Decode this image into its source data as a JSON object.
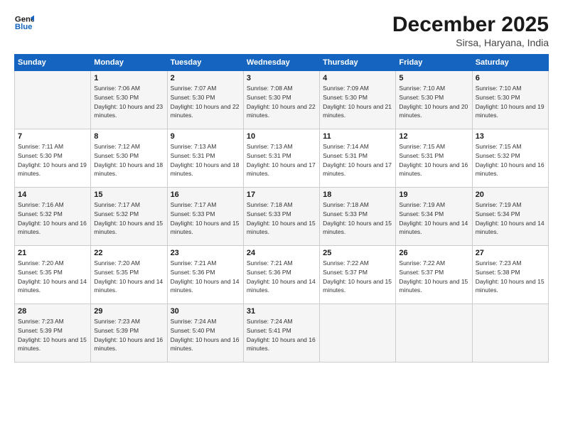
{
  "header": {
    "logo_line1": "General",
    "logo_line2": "Blue",
    "month": "December 2025",
    "location": "Sirsa, Haryana, India"
  },
  "weekdays": [
    "Sunday",
    "Monday",
    "Tuesday",
    "Wednesday",
    "Thursday",
    "Friday",
    "Saturday"
  ],
  "weeks": [
    [
      {
        "day": "",
        "sunrise": "",
        "sunset": "",
        "daylight": ""
      },
      {
        "day": "1",
        "sunrise": "Sunrise: 7:06 AM",
        "sunset": "Sunset: 5:30 PM",
        "daylight": "Daylight: 10 hours and 23 minutes."
      },
      {
        "day": "2",
        "sunrise": "Sunrise: 7:07 AM",
        "sunset": "Sunset: 5:30 PM",
        "daylight": "Daylight: 10 hours and 22 minutes."
      },
      {
        "day": "3",
        "sunrise": "Sunrise: 7:08 AM",
        "sunset": "Sunset: 5:30 PM",
        "daylight": "Daylight: 10 hours and 22 minutes."
      },
      {
        "day": "4",
        "sunrise": "Sunrise: 7:09 AM",
        "sunset": "Sunset: 5:30 PM",
        "daylight": "Daylight: 10 hours and 21 minutes."
      },
      {
        "day": "5",
        "sunrise": "Sunrise: 7:10 AM",
        "sunset": "Sunset: 5:30 PM",
        "daylight": "Daylight: 10 hours and 20 minutes."
      },
      {
        "day": "6",
        "sunrise": "Sunrise: 7:10 AM",
        "sunset": "Sunset: 5:30 PM",
        "daylight": "Daylight: 10 hours and 19 minutes."
      }
    ],
    [
      {
        "day": "7",
        "sunrise": "Sunrise: 7:11 AM",
        "sunset": "Sunset: 5:30 PM",
        "daylight": "Daylight: 10 hours and 19 minutes."
      },
      {
        "day": "8",
        "sunrise": "Sunrise: 7:12 AM",
        "sunset": "Sunset: 5:30 PM",
        "daylight": "Daylight: 10 hours and 18 minutes."
      },
      {
        "day": "9",
        "sunrise": "Sunrise: 7:13 AM",
        "sunset": "Sunset: 5:31 PM",
        "daylight": "Daylight: 10 hours and 18 minutes."
      },
      {
        "day": "10",
        "sunrise": "Sunrise: 7:13 AM",
        "sunset": "Sunset: 5:31 PM",
        "daylight": "Daylight: 10 hours and 17 minutes."
      },
      {
        "day": "11",
        "sunrise": "Sunrise: 7:14 AM",
        "sunset": "Sunset: 5:31 PM",
        "daylight": "Daylight: 10 hours and 17 minutes."
      },
      {
        "day": "12",
        "sunrise": "Sunrise: 7:15 AM",
        "sunset": "Sunset: 5:31 PM",
        "daylight": "Daylight: 10 hours and 16 minutes."
      },
      {
        "day": "13",
        "sunrise": "Sunrise: 7:15 AM",
        "sunset": "Sunset: 5:32 PM",
        "daylight": "Daylight: 10 hours and 16 minutes."
      }
    ],
    [
      {
        "day": "14",
        "sunrise": "Sunrise: 7:16 AM",
        "sunset": "Sunset: 5:32 PM",
        "daylight": "Daylight: 10 hours and 16 minutes."
      },
      {
        "day": "15",
        "sunrise": "Sunrise: 7:17 AM",
        "sunset": "Sunset: 5:32 PM",
        "daylight": "Daylight: 10 hours and 15 minutes."
      },
      {
        "day": "16",
        "sunrise": "Sunrise: 7:17 AM",
        "sunset": "Sunset: 5:33 PM",
        "daylight": "Daylight: 10 hours and 15 minutes."
      },
      {
        "day": "17",
        "sunrise": "Sunrise: 7:18 AM",
        "sunset": "Sunset: 5:33 PM",
        "daylight": "Daylight: 10 hours and 15 minutes."
      },
      {
        "day": "18",
        "sunrise": "Sunrise: 7:18 AM",
        "sunset": "Sunset: 5:33 PM",
        "daylight": "Daylight: 10 hours and 15 minutes."
      },
      {
        "day": "19",
        "sunrise": "Sunrise: 7:19 AM",
        "sunset": "Sunset: 5:34 PM",
        "daylight": "Daylight: 10 hours and 14 minutes."
      },
      {
        "day": "20",
        "sunrise": "Sunrise: 7:19 AM",
        "sunset": "Sunset: 5:34 PM",
        "daylight": "Daylight: 10 hours and 14 minutes."
      }
    ],
    [
      {
        "day": "21",
        "sunrise": "Sunrise: 7:20 AM",
        "sunset": "Sunset: 5:35 PM",
        "daylight": "Daylight: 10 hours and 14 minutes."
      },
      {
        "day": "22",
        "sunrise": "Sunrise: 7:20 AM",
        "sunset": "Sunset: 5:35 PM",
        "daylight": "Daylight: 10 hours and 14 minutes."
      },
      {
        "day": "23",
        "sunrise": "Sunrise: 7:21 AM",
        "sunset": "Sunset: 5:36 PM",
        "daylight": "Daylight: 10 hours and 14 minutes."
      },
      {
        "day": "24",
        "sunrise": "Sunrise: 7:21 AM",
        "sunset": "Sunset: 5:36 PM",
        "daylight": "Daylight: 10 hours and 14 minutes."
      },
      {
        "day": "25",
        "sunrise": "Sunrise: 7:22 AM",
        "sunset": "Sunset: 5:37 PM",
        "daylight": "Daylight: 10 hours and 15 minutes."
      },
      {
        "day": "26",
        "sunrise": "Sunrise: 7:22 AM",
        "sunset": "Sunset: 5:37 PM",
        "daylight": "Daylight: 10 hours and 15 minutes."
      },
      {
        "day": "27",
        "sunrise": "Sunrise: 7:23 AM",
        "sunset": "Sunset: 5:38 PM",
        "daylight": "Daylight: 10 hours and 15 minutes."
      }
    ],
    [
      {
        "day": "28",
        "sunrise": "Sunrise: 7:23 AM",
        "sunset": "Sunset: 5:39 PM",
        "daylight": "Daylight: 10 hours and 15 minutes."
      },
      {
        "day": "29",
        "sunrise": "Sunrise: 7:23 AM",
        "sunset": "Sunset: 5:39 PM",
        "daylight": "Daylight: 10 hours and 16 minutes."
      },
      {
        "day": "30",
        "sunrise": "Sunrise: 7:24 AM",
        "sunset": "Sunset: 5:40 PM",
        "daylight": "Daylight: 10 hours and 16 minutes."
      },
      {
        "day": "31",
        "sunrise": "Sunrise: 7:24 AM",
        "sunset": "Sunset: 5:41 PM",
        "daylight": "Daylight: 10 hours and 16 minutes."
      },
      {
        "day": "",
        "sunrise": "",
        "sunset": "",
        "daylight": ""
      },
      {
        "day": "",
        "sunrise": "",
        "sunset": "",
        "daylight": ""
      },
      {
        "day": "",
        "sunrise": "",
        "sunset": "",
        "daylight": ""
      }
    ]
  ]
}
